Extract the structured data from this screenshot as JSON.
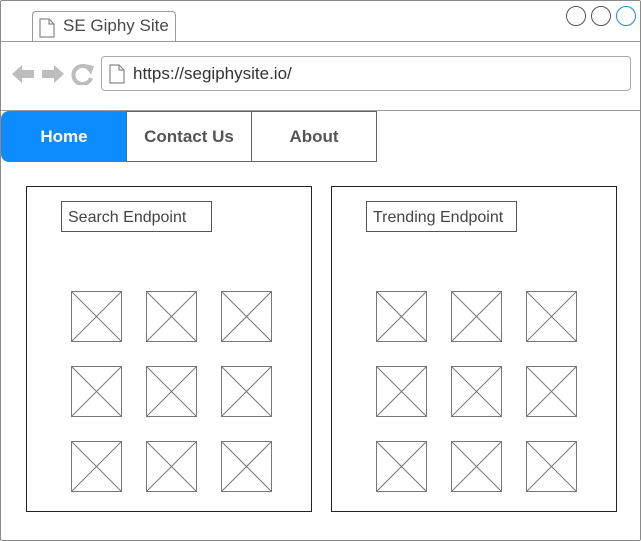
{
  "browser": {
    "tab_title": "SE Giphy Site",
    "url": "https://segiphysite.io/"
  },
  "navbar": {
    "items": [
      {
        "label": "Home",
        "active": true
      },
      {
        "label": "Contact Us",
        "active": false
      },
      {
        "label": "About",
        "active": false
      }
    ]
  },
  "panels": {
    "search": {
      "button_label": "Search Endpoint",
      "image_count": 9
    },
    "trending": {
      "button_label": "Trending Endpoint",
      "image_count": 9
    }
  },
  "colors": {
    "accent": "#0d8cff",
    "window_button_highlight": "#1a8fd6"
  },
  "icons": [
    "page-icon",
    "back-arrow-icon",
    "forward-arrow-icon",
    "reload-icon",
    "image-placeholder-icon"
  ]
}
